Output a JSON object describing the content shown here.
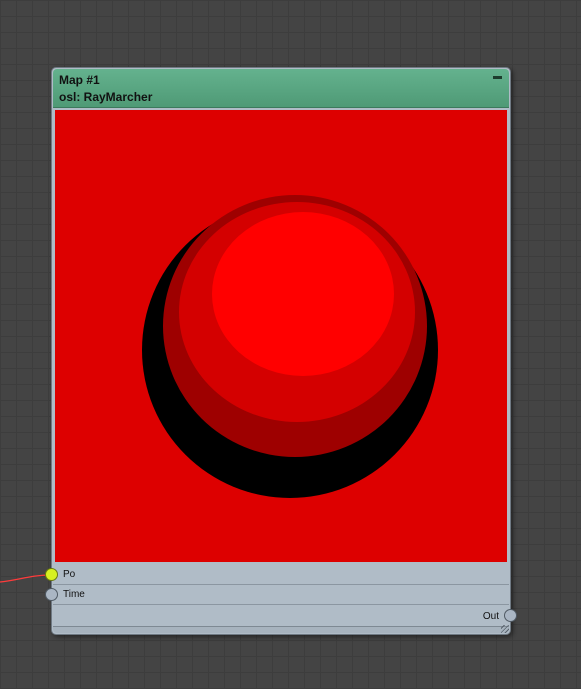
{
  "node": {
    "title": "Map #1",
    "subtitle": "osl: RayMarcher",
    "header_color": "#5aa884",
    "preview_background": "#dd0000",
    "preview_icon": "sphere-render",
    "inputs": [
      {
        "label": "Po",
        "connected": true,
        "socket_color": "#d7f021"
      },
      {
        "label": "Time",
        "connected": false,
        "socket_color": "#aab6c4"
      }
    ],
    "outputs": [
      {
        "label": "Out",
        "connected": false,
        "socket_color": "#aab6c4"
      }
    ]
  },
  "wire_color": "#ff3b3b",
  "canvas_background": "#444444"
}
